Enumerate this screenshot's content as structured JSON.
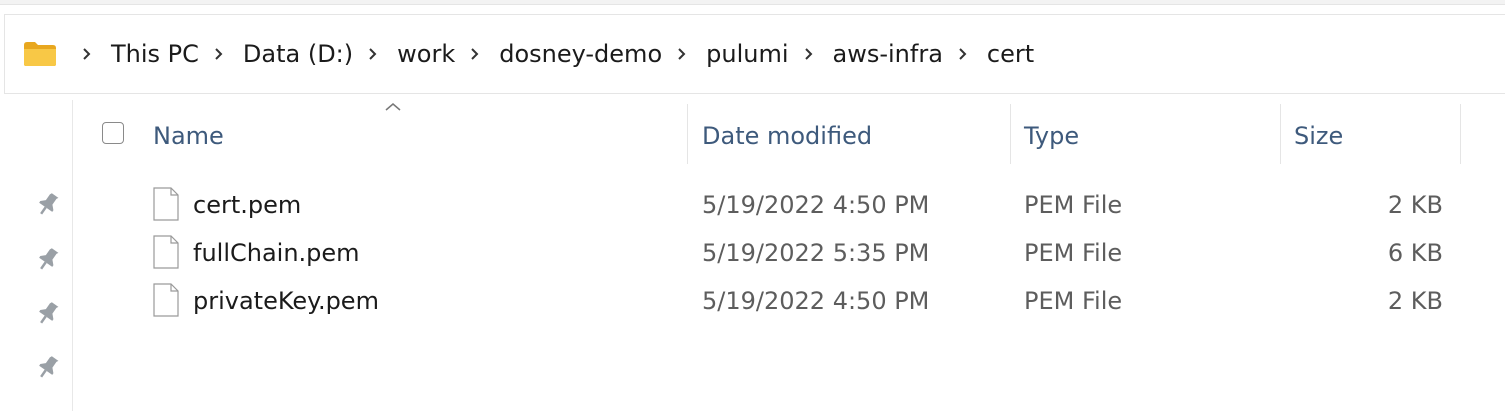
{
  "address_bar": {
    "folder_icon": "folder-icon",
    "separator_icon": "chevron-right-icon",
    "breadcrumbs": [
      "This PC",
      "Data (D:)",
      "work",
      "dosney-demo",
      "pulumi",
      "aws-infra",
      "cert"
    ]
  },
  "quick_access": {
    "pins": [
      "pin-icon",
      "pin-icon",
      "pin-icon",
      "pin-icon"
    ]
  },
  "file_list": {
    "sort_indicator": "sort-up-icon",
    "columns": {
      "name": "Name",
      "date_modified": "Date modified",
      "type": "Type",
      "size": "Size"
    },
    "files": [
      {
        "name": "cert.pem",
        "date_modified": "5/19/2022 4:50 PM",
        "type": "PEM File",
        "size": "2 KB"
      },
      {
        "name": "fullChain.pem",
        "date_modified": "5/19/2022 5:35 PM",
        "type": "PEM File",
        "size": "6 KB"
      },
      {
        "name": "privateKey.pem",
        "date_modified": "5/19/2022 4:50 PM",
        "type": "PEM File",
        "size": "2 KB"
      }
    ]
  },
  "colors": {
    "folder": "#f5c242",
    "header_text": "#3e5a7c",
    "secondary_text": "#5d5d5d"
  }
}
